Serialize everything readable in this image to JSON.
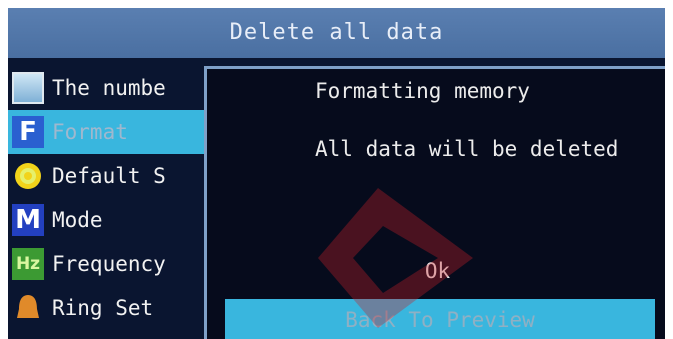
{
  "title": "Delete all data",
  "menu": {
    "items": [
      {
        "label": "The numbe",
        "icon": "picture-icon"
      },
      {
        "label": "Format",
        "icon": "format-f-icon",
        "selected": true
      },
      {
        "label": "Default S",
        "icon": "gear-icon"
      },
      {
        "label": "Mode",
        "icon": "mode-m-icon"
      },
      {
        "label": "Frequency",
        "icon": "hz-icon"
      },
      {
        "label": "Ring Set",
        "icon": "bell-icon"
      }
    ]
  },
  "dialog": {
    "title": "Formatting memory",
    "message": "All data will be deleted",
    "ok_label": "Ok",
    "back_label": "Back To Preview"
  },
  "colors": {
    "titlebar": "#4a6fa1",
    "highlight": "#39b6de",
    "background": "#0a1530",
    "dialog_bg": "#060b1c",
    "watermark": "#c8202a"
  }
}
